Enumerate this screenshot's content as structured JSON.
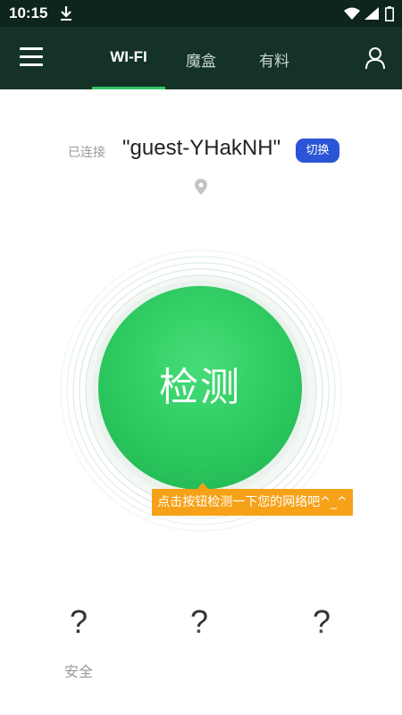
{
  "status_bar": {
    "time": "10:15",
    "icons": [
      "download-icon",
      "wifi-signal-icon",
      "cell-signal-icon",
      "battery-icon"
    ]
  },
  "app_bar": {
    "menu_icon": "hamburger-menu-icon",
    "tabs": [
      {
        "label": "WI-FI",
        "active": true
      },
      {
        "label": "魔盒",
        "active": false
      },
      {
        "label": "有料",
        "active": false
      }
    ],
    "profile_icon": "user-icon",
    "accent_color": "#2fc866",
    "background_color": "#143326"
  },
  "connection": {
    "status_label": "已连接",
    "ssid": "\"guest-YHakNH\"",
    "switch_label": "切换",
    "location_icon": "location-pin-icon"
  },
  "detect": {
    "button_label": "检测",
    "tooltip": "点击按钮检测一下您的网络吧^_^",
    "button_color": "#2cc95f",
    "tooltip_color": "#f6a117"
  },
  "stats": [
    {
      "value": "?",
      "label": "安全"
    },
    {
      "value": "?",
      "label": ""
    },
    {
      "value": "?",
      "label": ""
    }
  ]
}
